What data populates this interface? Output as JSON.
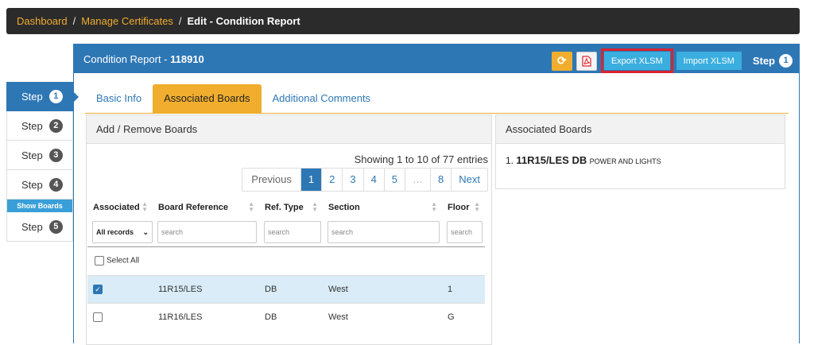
{
  "breadcrumb": {
    "dashboard": "Dashboard",
    "manage": "Manage Certificates",
    "current": "Edit - Condition Report",
    "separator": "/"
  },
  "sidebar": {
    "steps": [
      {
        "label": "Step",
        "num": "1"
      },
      {
        "label": "Step",
        "num": "2"
      },
      {
        "label": "Step",
        "num": "3"
      },
      {
        "label": "Step",
        "num": "4"
      },
      {
        "label": "Step",
        "num": "5"
      }
    ],
    "show_boards": "Show Boards"
  },
  "panel": {
    "title_label": "Condition Report - ",
    "title_id": "118910",
    "export": "Export XLSM",
    "import": "Import XLSM",
    "step_label": "Step",
    "step_num": "1",
    "refresh_icon": "refresh-icon",
    "pdf_icon": "pdf-icon"
  },
  "tabs": [
    "Basic Info",
    "Associated Boards",
    "Additional Comments"
  ],
  "left_box": {
    "title": "Add / Remove Boards",
    "entries": "Showing 1 to 10 of 77 entries",
    "pager": [
      "Previous",
      "1",
      "2",
      "3",
      "4",
      "5",
      "…",
      "8",
      "Next"
    ],
    "columns": [
      "Associated",
      "Board Reference",
      "Ref. Type",
      "Section",
      "Floor"
    ],
    "filter_select": "All records",
    "search_placeholder": "search",
    "select_all": "Select All",
    "rows": [
      {
        "checked": true,
        "ref": "11R15/LES",
        "type": "DB",
        "section": "West",
        "floor": "1"
      },
      {
        "checked": false,
        "ref": "11R16/LES",
        "type": "DB",
        "section": "West",
        "floor": "G"
      }
    ]
  },
  "right_box": {
    "title": "Associated Boards",
    "item_prefix": "1.",
    "item_ref": "11R15/LES DB",
    "item_desc": "POWER AND LIGHTS"
  },
  "colors": {
    "primary": "#2e77b5",
    "accent": "#f0ad2e",
    "info": "#3aaedf",
    "highlight": "#d9232e"
  }
}
